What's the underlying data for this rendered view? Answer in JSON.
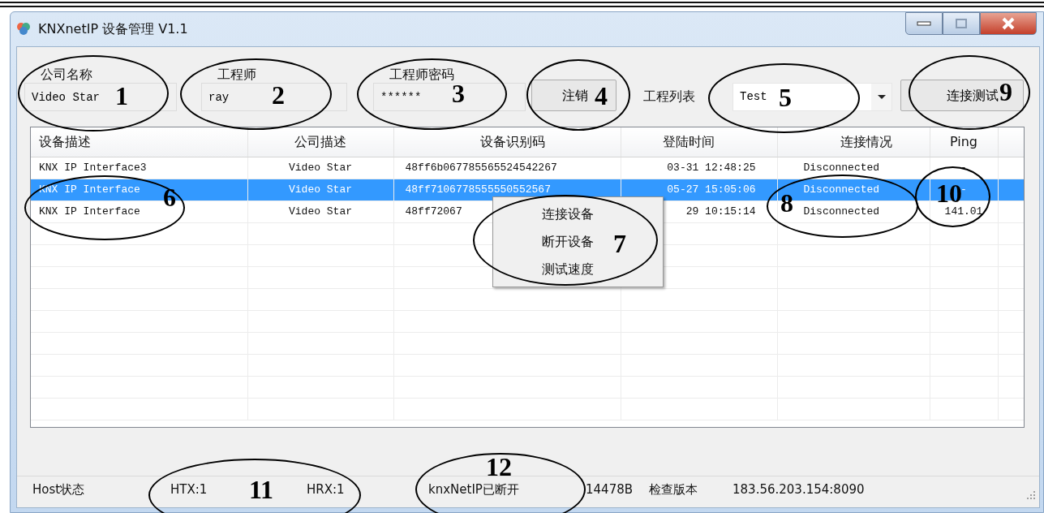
{
  "window": {
    "title": "KNXnetIP 设备管理 V1.1"
  },
  "form": {
    "company": {
      "label": "公司名称",
      "value": "Video Star"
    },
    "engineer": {
      "label": "工程师",
      "value": "ray"
    },
    "password": {
      "label": "工程师密码",
      "value": "******"
    },
    "logout_button": "注销",
    "project_list": {
      "label": "工程列表",
      "value": "Test"
    },
    "connect_test_button": "连接测试"
  },
  "table": {
    "columns": [
      "设备描述",
      "公司描述",
      "设备识别码",
      "登陆时间",
      "连接情况",
      "Ping"
    ],
    "rows": [
      {
        "selected": false,
        "cells": [
          "KNX IP Interface3",
          "Video Star",
          "48ff6b067785565524542267",
          "03-31 12:48:25",
          "Disconnected",
          "-"
        ]
      },
      {
        "selected": true,
        "cells": [
          "KNX IP Interface",
          "Video Star",
          "48ff7106778555550552567",
          "05-27 15:05:06",
          "Disconnected",
          "-"
        ]
      },
      {
        "selected": false,
        "cells": [
          "KNX IP Interface",
          "Video Star",
          "48ff72067",
          "29 10:15:14",
          "Disconnected",
          "141.01"
        ]
      }
    ]
  },
  "context_menu": {
    "items": [
      "连接设备",
      "断开设备",
      "测试速度"
    ]
  },
  "status_bar": {
    "items": [
      "Host状态",
      "HTX:1",
      "HRX:1",
      "knxNetIP已断开",
      "14478B",
      "检查版本",
      "183.56.203.154:8090"
    ]
  },
  "annotations": [
    {
      "number": "1"
    },
    {
      "number": "2"
    },
    {
      "number": "3"
    },
    {
      "number": "4"
    },
    {
      "number": "5"
    },
    {
      "number": "9"
    },
    {
      "number": "6"
    },
    {
      "number": "7"
    },
    {
      "number": "8"
    },
    {
      "number": "10"
    },
    {
      "number": "11"
    },
    {
      "number": "12"
    }
  ]
}
